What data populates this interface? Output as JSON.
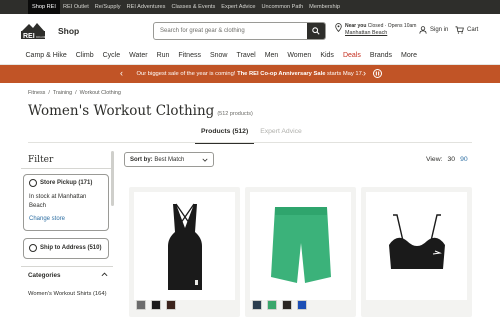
{
  "topbar": {
    "links": [
      "Shop REI",
      "REI Outlet",
      "Re/Supply",
      "REI Adventures",
      "Classes & Events",
      "Expert Advice",
      "Uncommon Path",
      "Membership"
    ]
  },
  "header": {
    "logo_text": "REI",
    "shop_label": "Shop",
    "search_placeholder": "Search for great gear & clothing",
    "store_near": "Near you",
    "store_status": "Closed · Opens 10am",
    "store_name": "Manhattan Beach",
    "signin_label": "Sign in",
    "cart_label": "Cart"
  },
  "nav": [
    "Camp & Hike",
    "Climb",
    "Cycle",
    "Water",
    "Run",
    "Fitness",
    "Snow",
    "Travel",
    "Men",
    "Women",
    "Kids",
    "Deals",
    "Brands",
    "More"
  ],
  "banner": {
    "text": "Our biggest sale of the year is coming! ",
    "bold": "The REI Co-op Anniversary Sale",
    "tail": " starts May 17."
  },
  "breadcrumbs": [
    "Fitness",
    "/",
    "Training",
    "/",
    "Workout Clothing"
  ],
  "page": {
    "title": "Women's Workout Clothing",
    "count": "(512 products)"
  },
  "tabs": [
    "Products (512)",
    "Expert Advice"
  ],
  "filter": {
    "heading": "Filter",
    "store_pickup": "Store Pickup (171)",
    "in_stock": "In stock at Manhattan Beach",
    "change_store": "Change store",
    "ship": "Ship to Address (510)",
    "categories_label": "Categories",
    "category_items": [
      "Women's Workout Shirts (164)"
    ]
  },
  "sort": {
    "label": "Sort by:",
    "value": "Best Match"
  },
  "view": {
    "label": "View:",
    "options": [
      "30",
      "90"
    ]
  },
  "products": [
    {
      "swatches": [
        "#6b6b6b",
        "#1c1c1c",
        "#3b231c"
      ]
    },
    {
      "swatches": [
        "#2c3e4e",
        "#3aa66b",
        "#2a2622",
        "#1d4fb5"
      ]
    },
    {
      "swatches": [
        "#1a1a1a"
      ]
    }
  ],
  "colors": {
    "topbar_bg": "#2e2e2b",
    "banner_bg": "#c15426",
    "deals": "#c52e1f",
    "link": "#2e6fa3"
  }
}
